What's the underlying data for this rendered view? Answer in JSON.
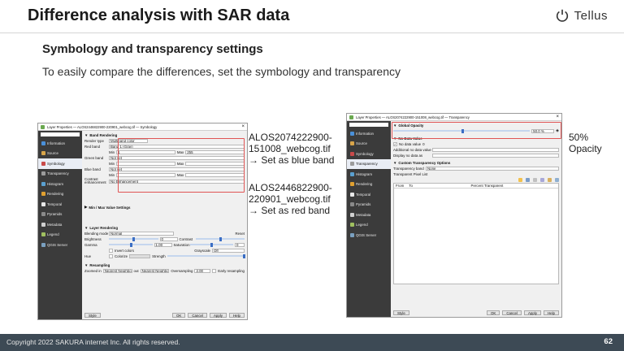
{
  "slide": {
    "title": "Difference analysis with SAR data",
    "subtitle": "Symbology and transparency settings",
    "description": "To easily compare the differences, set the symbology and transparency",
    "logo_text": "Tellus",
    "footer_copyright": "Copyright 2022 SAKURA internet Inc. All rights reserved.",
    "page_number": "62"
  },
  "sidebar_items": [
    "Information",
    "Source",
    "Symbology",
    "Transparency",
    "Histogram",
    "Rendering",
    "Temporal",
    "Pyramids",
    "Metadata",
    "Legend",
    "QGIS Server"
  ],
  "symbology_dialog": {
    "title": "Layer Properties — ALOS2446822900-220901_webcog.tif — Symbology",
    "band_rendering_header": "Band Rendering",
    "render_type_label": "Render type",
    "render_type_value": "Multiband color",
    "red_band_label": "Red band",
    "red_band_value": "Band 1 (Gray)",
    "min_label": "Min",
    "max_label": "Max",
    "red_min": "1",
    "red_max": "255",
    "green_band_label": "Green band",
    "green_band_value": "Not set",
    "blue_band_label": "Blue band",
    "blue_band_value": "Not set",
    "contrast_label": "Contrast enhancement",
    "contrast_value": "No Enhancement",
    "minmax_header": "Min / Max Value Settings",
    "layer_rendering_header": "Layer Rendering",
    "blending_label": "Blending mode",
    "blending_value": "Normal",
    "reset_label": "Reset",
    "brightness_label": "Brightness",
    "brightness_value": "0",
    "contrast2_label": "Contrast",
    "gamma_label": "Gamma",
    "gamma_value": "1.00",
    "saturation_label": "Saturation",
    "saturation_value": "0",
    "invert_label": "Invert colors",
    "grayscale_label": "Grayscale",
    "grayscale_value": "Off",
    "hue_label": "Hue",
    "colorize_label": "Colorize",
    "strength_label": "Strength",
    "resampling_header": "Resampling",
    "zoomed_in_label": "Zoomed in",
    "zoomed_in_value": "Nearest Neighbour",
    "out_label": "out",
    "zoomed_out_value": "Nearest Neighbour",
    "oversampling_label": "Oversampling",
    "oversampling_value": "2.00",
    "early_resampling_label": "Early resampling",
    "style_btn": "Style",
    "ok_btn": "OK",
    "cancel_btn": "Cancel",
    "apply_btn": "Apply",
    "help_btn": "Help"
  },
  "transparency_dialog": {
    "title": "Layer Properties — ALOS2074222900-151008_webcog.tif — Transparency",
    "global_opacity_header": "Global Opacity",
    "opacity_value": "50.0 %",
    "opacity_fraction": 0.5,
    "no_data_header": "No Data Value",
    "no_data_label": "No data value",
    "no_data_value": "0",
    "additional_no_data_label": "Additional no data value",
    "display_no_data_label": "Display no data as",
    "custom_transparency_header": "Custom Transparency Options",
    "transparency_band_label": "Transparency band",
    "transparency_band_value": "None",
    "pixel_list_label": "Transparent Pixel List",
    "col_from": "From",
    "col_to": "To",
    "col_percent": "Percent Transparent",
    "style_btn": "Style",
    "ok_btn": "OK",
    "cancel_btn": "Cancel",
    "apply_btn": "Apply",
    "help_btn": "Help"
  },
  "annotations": {
    "blue_line1": "ALOS2074222900-",
    "blue_line2": "151008_webcog.tif",
    "blue_line3": "→ Set as blue band",
    "red_line1": "ALOS2446822900-",
    "red_line2": "220901_webcog.tif",
    "red_line3": "→ Set as red band",
    "opacity_line1": "50%",
    "opacity_line2": "Opacity"
  },
  "colors": {
    "footer_bg": "#3d4a55",
    "highlight_red": "#e05555",
    "sidebar_bg": "#3b3b3b",
    "active_blue": "#3b6ec4"
  }
}
